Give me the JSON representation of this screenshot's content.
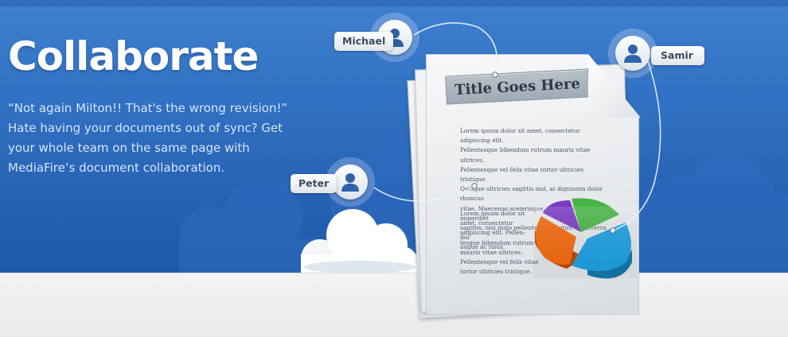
{
  "hero": {
    "headline": "Collaborate",
    "body_lines": [
      "“Not again Milton!! That's the wrong revision!”",
      "Hate having your documents out of sync? Get",
      "your whole team on the same page with",
      "MediaFire’s document collaboration."
    ]
  },
  "document": {
    "title": "Title Goes Here",
    "paragraph_1": [
      "Lorem ipsum dolor sit amet, consectetur adipiscing elit.",
      "Pellentesque bibendum rutrum mauris vitae ultrices.",
      "Pellentesque vel felis vitae tortor ultricies tristique.",
      "Quisque ultricies sagittis nisl, at dignissim dolor rhoncus",
      "vitae. Maecenas scelerisque, tortor viverra imperdiet",
      "sagittis, nisl justo pellentesque metus, vel viverra dui",
      "augue ac risus."
    ],
    "paragraph_2": [
      "Lorem ipsum dolor sit",
      "amet, consectetur",
      "adipiscing elit. Pellen-",
      "tesque bibendum rutrum",
      "mauris vitae ultrices.",
      "Pellentesque vel felis vitae",
      "tortor ultricies tristique."
    ],
    "pie_colors": [
      "#7a3bc2",
      "#49b346",
      "#1e9fe0",
      "#f06a10"
    ]
  },
  "users": [
    {
      "name": "Michael",
      "icon": "user-icon"
    },
    {
      "name": "Samir",
      "icon": "user-icon"
    },
    {
      "name": "Peter",
      "icon": "user-icon"
    }
  ],
  "colors": {
    "sky": "#2f6fc2",
    "ground": "#eef0f2",
    "name_text": "#3b4c63",
    "avatar_icon": "#2e63a8"
  }
}
